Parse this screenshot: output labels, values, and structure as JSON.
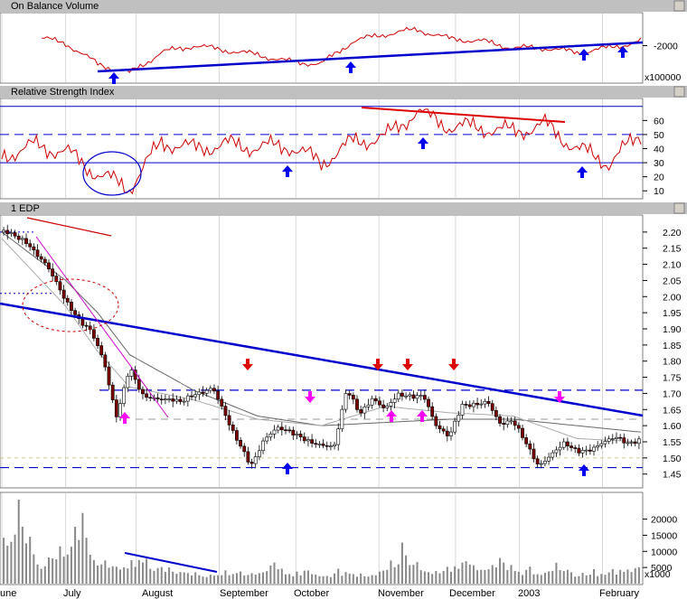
{
  "colors": {
    "panel_header": "#c0c0c0",
    "obv_line": "#cc0000",
    "trend_blue": "#0000cc",
    "arrow_blue": "#0000ee",
    "arrow_red": "#dd0000",
    "arrow_magenta": "#ff00ff",
    "candle_up": "#ffffff",
    "candle_down": "#7a0000",
    "ma_short": "#aaaaaa",
    "ma_long": "#666666",
    "volume_bar": "#888888"
  },
  "panels": {
    "obv": {
      "title": "On Balance Volume",
      "multiplier": "x100000"
    },
    "rsi": {
      "title": "Relative Strength Index"
    },
    "price": {
      "title": "1 EDP"
    },
    "volume": {
      "multiplier": "x1000"
    }
  },
  "x_axis": {
    "months": [
      "June",
      "July",
      "August",
      "September",
      "October",
      "November",
      "December",
      "2003",
      "February"
    ],
    "month_labels": [
      "une",
      "July",
      "August",
      "September",
      "October",
      "November",
      "December",
      "2003",
      "February"
    ]
  },
  "chart_data": [
    {
      "type": "line",
      "title": "On Balance Volume",
      "y_ticks": [
        "-2000"
      ],
      "multiplier": "x100000",
      "series": [
        {
          "x": [
            0,
            5,
            10,
            15,
            20,
            25,
            30,
            35,
            40,
            45,
            50,
            55,
            60,
            65,
            70,
            75,
            80,
            85,
            90,
            95,
            100
          ],
          "values": [
            -1500,
            -1800,
            -1950,
            -2400,
            -2600,
            -2150,
            -2000,
            -2100,
            -2200,
            -2350,
            -2400,
            -1900,
            -1750,
            -1650,
            -1850,
            -1900,
            -2050,
            -2050,
            -2150,
            -2050,
            -1900
          ]
        }
      ],
      "annotations": [
        "uptrend line",
        "blue up-arrows at trend touches"
      ]
    },
    {
      "type": "line",
      "title": "Relative Strength Index",
      "y_ticks": [
        60,
        50,
        40,
        30,
        20,
        10
      ],
      "ylim": [
        5,
        70
      ],
      "reference_lines": [
        30,
        50
      ],
      "series": [
        {
          "x": [
            0,
            5,
            10,
            15,
            20,
            25,
            30,
            35,
            40,
            45,
            50,
            55,
            60,
            65,
            70,
            75,
            80,
            85,
            90,
            95,
            100
          ],
          "values": [
            35,
            42,
            38,
            22,
            12,
            45,
            40,
            43,
            41,
            42,
            30,
            45,
            48,
            67,
            56,
            55,
            52,
            57,
            40,
            30,
            50
          ]
        }
      ]
    },
    {
      "type": "candlestick",
      "title": "1 EDP",
      "y_ticks": [
        2.2,
        2.15,
        2.1,
        2.05,
        2.0,
        1.95,
        1.9,
        1.85,
        1.8,
        1.75,
        1.7,
        1.65,
        1.6,
        1.55,
        1.5,
        1.45
      ],
      "ylim": [
        1.41,
        2.25
      ],
      "close_path": {
        "x": [
          0,
          4,
          7,
          10,
          12,
          14,
          16,
          17,
          18,
          20,
          22,
          25,
          28,
          30,
          33,
          36,
          39,
          41,
          43,
          46,
          49,
          52,
          54,
          56,
          58,
          60,
          62,
          64,
          66,
          68,
          70,
          72,
          74,
          76,
          78,
          80,
          82,
          84,
          86,
          88,
          90,
          92,
          94,
          96,
          98,
          100
        ],
        "values": [
          2.2,
          2.17,
          2.1,
          1.98,
          1.93,
          1.9,
          1.8,
          1.7,
          1.62,
          1.78,
          1.7,
          1.68,
          1.67,
          1.7,
          1.72,
          1.58,
          1.48,
          1.56,
          1.59,
          1.57,
          1.55,
          1.53,
          1.71,
          1.64,
          1.69,
          1.65,
          1.69,
          1.69,
          1.7,
          1.6,
          1.56,
          1.66,
          1.67,
          1.68,
          1.6,
          1.61,
          1.55,
          1.48,
          1.51,
          1.54,
          1.52,
          1.53,
          1.55,
          1.56,
          1.54,
          1.56
        ]
      },
      "moving_averages": [
        {
          "name": "short",
          "x": [
            0,
            10,
            15,
            20,
            30,
            40,
            50,
            60,
            70,
            80,
            90,
            100
          ],
          "values": [
            2.18,
            1.97,
            1.83,
            1.72,
            1.68,
            1.62,
            1.6,
            1.66,
            1.64,
            1.63,
            1.56,
            1.55
          ]
        },
        {
          "name": "long",
          "x": [
            0,
            10,
            15,
            20,
            30,
            40,
            50,
            60,
            70,
            80,
            90,
            100
          ],
          "values": [
            2.2,
            2.05,
            1.95,
            1.82,
            1.71,
            1.63,
            1.6,
            1.61,
            1.62,
            1.62,
            1.6,
            1.58
          ]
        }
      ],
      "levels": [
        1.71,
        1.62,
        1.47,
        1.6
      ],
      "annotations": [
        "downtrend line",
        "support and resistance levels",
        "dotted circle around July pattern",
        "red down-arrows",
        "magenta up/down arrows",
        "blue up-arrows at lows"
      ]
    },
    {
      "type": "bar",
      "title": "",
      "y_ticks": [
        20000,
        15000,
        10000,
        5000
      ],
      "ylim": [
        0,
        28000
      ],
      "multiplier": "x1000",
      "series": [
        {
          "x": [
            0,
            3,
            6,
            9,
            12,
            15,
            18,
            21,
            24,
            27,
            30,
            33,
            36,
            39,
            42,
            45,
            48,
            51,
            54,
            57,
            60,
            63,
            66,
            69,
            72,
            75,
            78,
            81,
            84,
            87,
            90,
            93,
            96,
            99
          ],
          "values": [
            15000,
            24000,
            8000,
            12000,
            21000,
            10000,
            6000,
            9000,
            7000,
            5000,
            4000,
            3000,
            5000,
            3500,
            7000,
            4000,
            5000,
            3000,
            4500,
            3000,
            6000,
            11000,
            5500,
            5000,
            8000,
            6000,
            9000,
            5000,
            4000,
            7000,
            3500,
            4000,
            5000,
            6000
          ]
        }
      ],
      "annotations": [
        "declining volume trend line in August"
      ]
    }
  ]
}
